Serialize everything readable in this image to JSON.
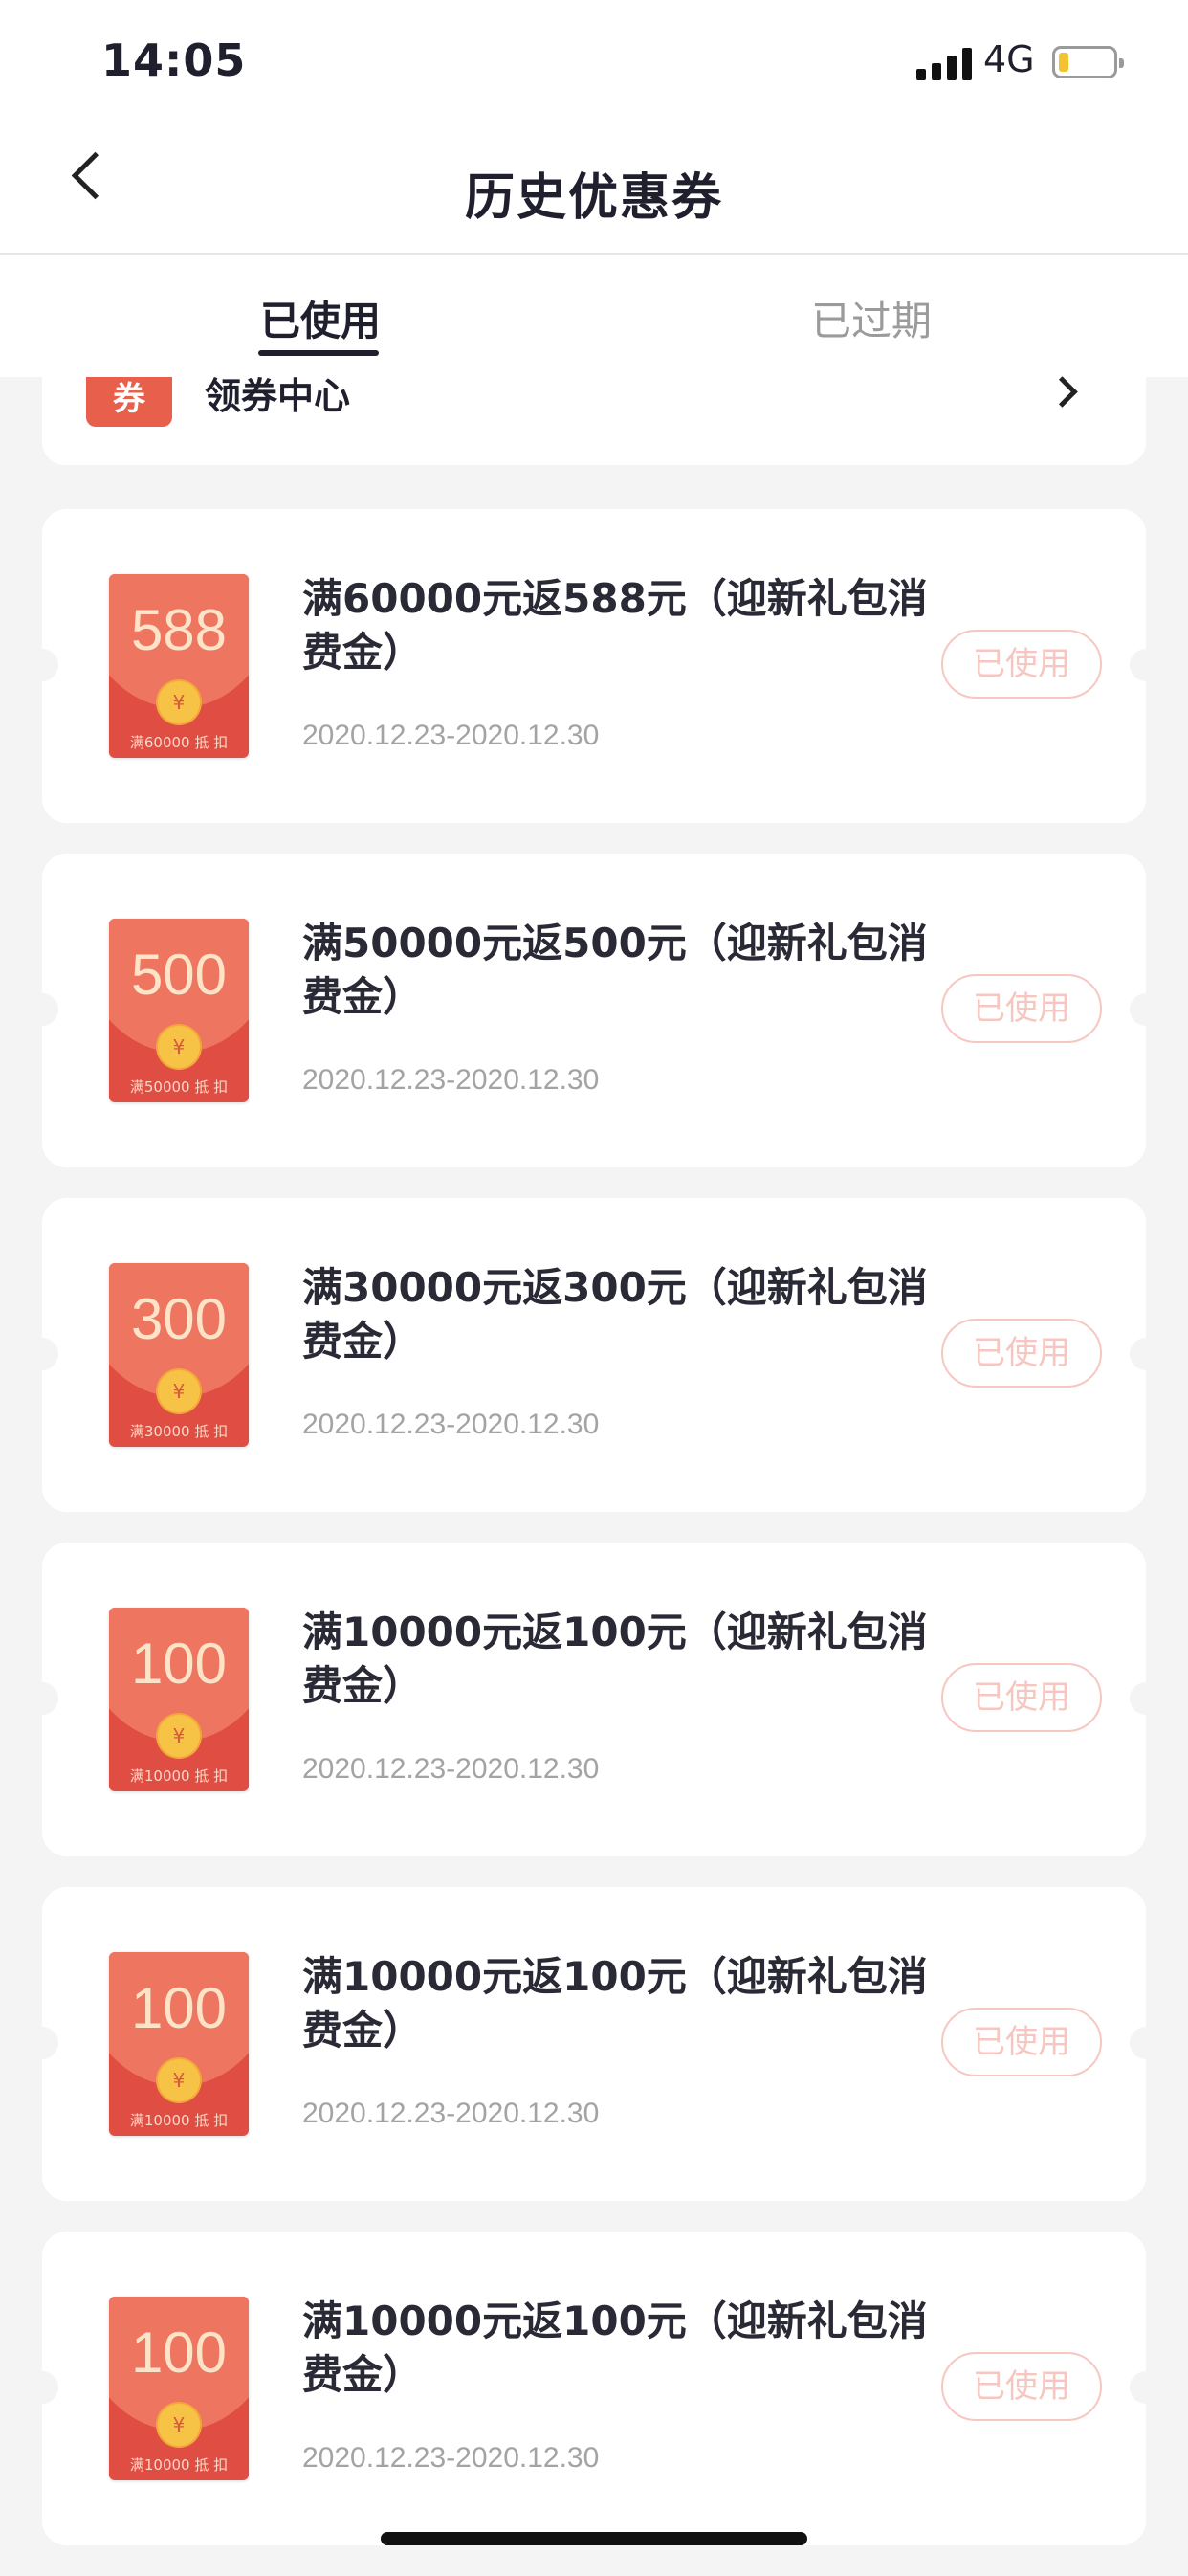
{
  "status_bar": {
    "time": "14:05",
    "network": "4G"
  },
  "nav": {
    "title": "历史优惠券"
  },
  "tabs": [
    {
      "label": "已使用",
      "active": true
    },
    {
      "label": "已过期",
      "active": false
    }
  ],
  "coupon_center": {
    "tag": "券",
    "label": "领券中心"
  },
  "colors": {
    "accent": "#e8604c",
    "status_text": "#f6c7c1",
    "page_bg": "#f4f4f4"
  },
  "coupons": [
    {
      "amount": "588",
      "condition": "满60000 抵 扣",
      "title": "满60000元返588元（迎新礼包消费金）",
      "date": "2020.12.23-2020.12.30",
      "status": "已使用"
    },
    {
      "amount": "500",
      "condition": "满50000 抵 扣",
      "title": "满50000元返500元（迎新礼包消费金）",
      "date": "2020.12.23-2020.12.30",
      "status": "已使用"
    },
    {
      "amount": "300",
      "condition": "满30000 抵 扣",
      "title": "满30000元返300元（迎新礼包消费金）",
      "date": "2020.12.23-2020.12.30",
      "status": "已使用"
    },
    {
      "amount": "100",
      "condition": "满10000 抵 扣",
      "title": "满10000元返100元（迎新礼包消费金）",
      "date": "2020.12.23-2020.12.30",
      "status": "已使用"
    },
    {
      "amount": "100",
      "condition": "满10000 抵 扣",
      "title": "满10000元返100元（迎新礼包消费金）",
      "date": "2020.12.23-2020.12.30",
      "status": "已使用"
    },
    {
      "amount": "100",
      "condition": "满10000 抵 扣",
      "title": "满10000元返100元（迎新礼包消费金）",
      "date": "2020.12.23-2020.12.30",
      "status": "已使用"
    }
  ],
  "icons": {
    "coin": "¥",
    "back": "chevron-left-icon",
    "forward": "chevron-right-icon"
  }
}
